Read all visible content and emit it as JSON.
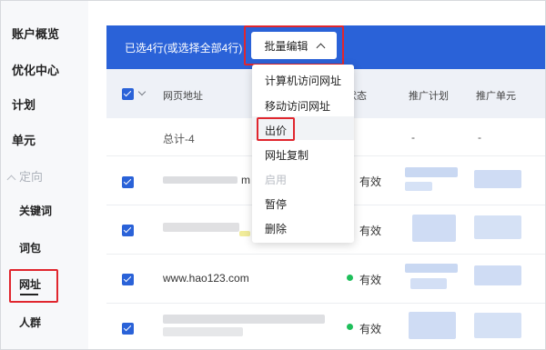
{
  "sidebar": {
    "items": [
      {
        "label": "账户概览"
      },
      {
        "label": "优化中心"
      },
      {
        "label": "计划"
      },
      {
        "label": "单元"
      }
    ],
    "group_label": "定向",
    "sub_items": [
      {
        "label": "关键词"
      },
      {
        "label": "词包"
      },
      {
        "label": "网址"
      },
      {
        "label": "人群"
      }
    ]
  },
  "toolbar": {
    "selection_text": "已选4行(或选择全部4行)",
    "batch_edit_label": "批量编辑"
  },
  "table": {
    "headers": [
      "网页地址",
      "状态",
      "推广计划",
      "推广单元"
    ],
    "total_label": "总计-4",
    "total_dash": "-",
    "rows": [
      {
        "url_suffix": "m",
        "status": "有效"
      },
      {
        "url_suffix": "",
        "status": "有效"
      },
      {
        "url": "www.hao123.com",
        "status": "有效"
      },
      {
        "url_suffix": "",
        "status": "有效"
      }
    ]
  },
  "menu": {
    "items": [
      "计算机访问网址",
      "移动访问网址",
      "出价",
      "网址复制",
      "启用",
      "暂停",
      "删除"
    ]
  },
  "colors": {
    "accent": "#2a62d8",
    "highlight": "#e0262e",
    "status_green": "#1fbf5b"
  }
}
